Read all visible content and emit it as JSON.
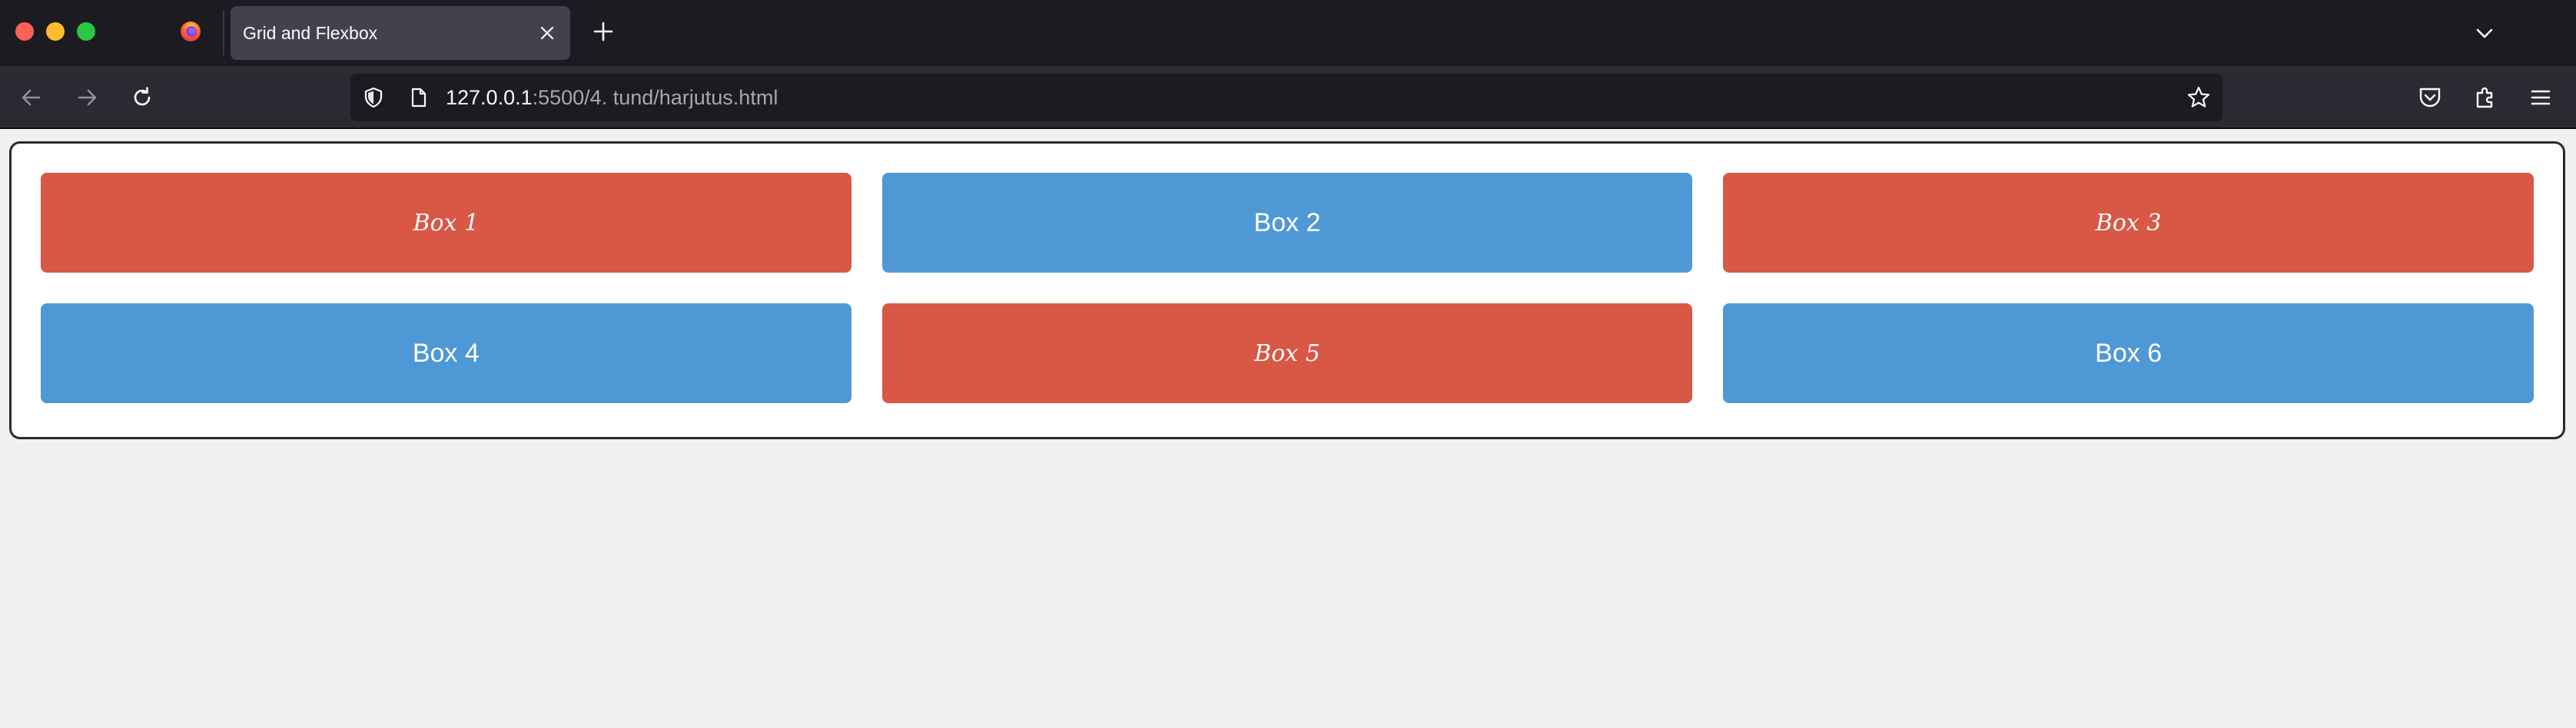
{
  "browser": {
    "tab": {
      "title": "Grid and Flexbox"
    },
    "url": {
      "host": "127.0.0.1",
      "rest": ":5500/4. tund/harjutus.html"
    },
    "colors": {
      "chrome_dark": "#1c1b22",
      "toolbar": "#2b2a33",
      "tab_active": "#42414d"
    }
  },
  "page": {
    "boxes": [
      {
        "label": "Box 1",
        "color": "#d95745"
      },
      {
        "label": "Box 2",
        "color": "#4f98d6"
      },
      {
        "label": "Box 3",
        "color": "#d95745"
      },
      {
        "label": "Box 4",
        "color": "#4f98d6"
      },
      {
        "label": "Box 5",
        "color": "#d95745"
      },
      {
        "label": "Box 6",
        "color": "#4f98d6"
      }
    ]
  }
}
